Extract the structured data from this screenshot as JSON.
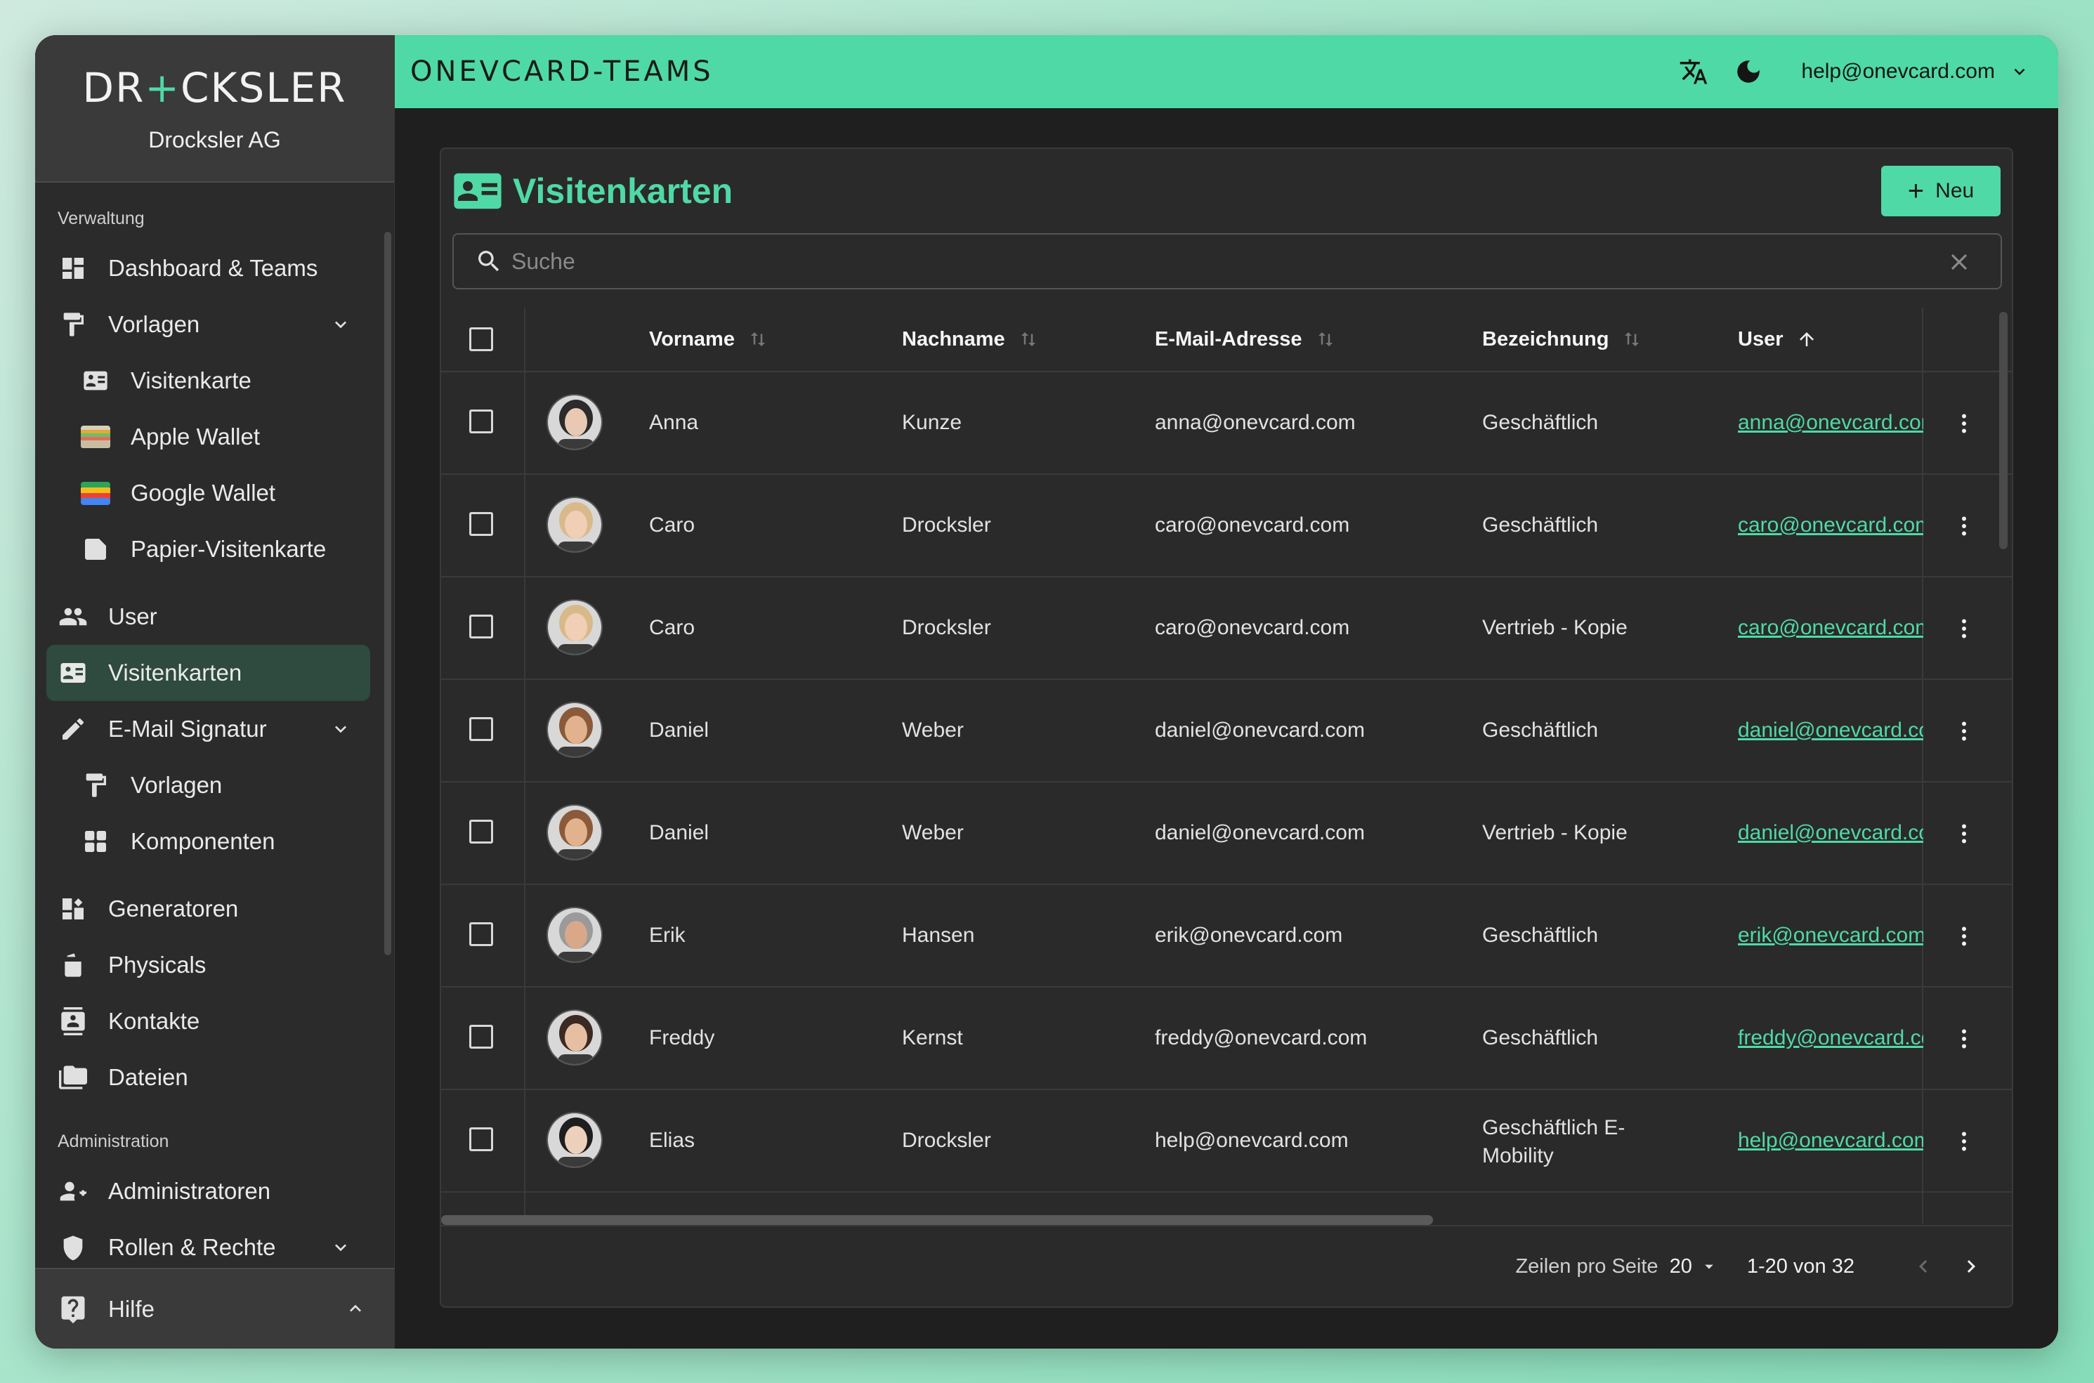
{
  "brand": {
    "logo_text": "DR+CKSLER",
    "logo_left": "DR",
    "logo_plus": "+",
    "logo_right": "CKSLER",
    "company": "Drocksler AG"
  },
  "topbar": {
    "app_title": "ONEVCARD-TEAMS",
    "user_email": "help@onevcard.com",
    "accent_color": "#4fd9a6"
  },
  "sidebar": {
    "section_management": "Verwaltung",
    "items": [
      {
        "label": "Dashboard & Teams",
        "icon": "dashboard-icon"
      },
      {
        "label": "Vorlagen",
        "icon": "paint-roller-icon",
        "expanded": true
      },
      {
        "label": "Visitenkarte",
        "icon": "contact-card-icon"
      },
      {
        "label": "Apple Wallet",
        "icon": "apple-wallet-icon"
      },
      {
        "label": "Google Wallet",
        "icon": "google-wallet-icon"
      },
      {
        "label": "Papier-Visitenkarte",
        "icon": "paper-card-icon"
      },
      {
        "label": "User",
        "icon": "users-icon"
      },
      {
        "label": "Visitenkarten",
        "icon": "contact-card-icon",
        "active": true
      },
      {
        "label": "E-Mail Signatur",
        "icon": "signature-icon",
        "expanded": true
      },
      {
        "label": "Vorlagen",
        "icon": "paint-roller-icon"
      },
      {
        "label": "Komponenten",
        "icon": "components-icon"
      },
      {
        "label": "Generatoren",
        "icon": "generators-icon"
      },
      {
        "label": "Physicals",
        "icon": "physicals-icon"
      },
      {
        "label": "Kontakte",
        "icon": "contacts-icon"
      },
      {
        "label": "Dateien",
        "icon": "folder-icon"
      }
    ],
    "section_admin": "Administration",
    "admin_items": [
      {
        "label": "Administratoren",
        "icon": "admin-icon"
      },
      {
        "label": "Rollen & Rechte",
        "icon": "roles-icon"
      }
    ],
    "help_label": "Hilfe"
  },
  "page": {
    "title": "Visitenkarten",
    "new_button": "Neu",
    "search_placeholder": "Suche"
  },
  "table": {
    "columns": [
      "Vorname",
      "Nachname",
      "E-Mail-Adresse",
      "Bezeichnung",
      "User"
    ],
    "rows": [
      {
        "first": "Anna",
        "last": "Kunze",
        "email": "anna@onevcard.com",
        "bez": "Geschäftlich",
        "user": "anna@onevcard.com"
      },
      {
        "first": "Caro",
        "last": "Drocksler",
        "email": "caro@onevcard.com",
        "bez": "Geschäftlich",
        "user": "caro@onevcard.com"
      },
      {
        "first": "Caro",
        "last": "Drocksler",
        "email": "caro@onevcard.com",
        "bez": "Vertrieb - Kopie",
        "user": "caro@onevcard.com"
      },
      {
        "first": "Daniel",
        "last": "Weber",
        "email": "daniel@onevcard.com",
        "bez": "Geschäftlich",
        "user": "daniel@onevcard.com"
      },
      {
        "first": "Daniel",
        "last": "Weber",
        "email": "daniel@onevcard.com",
        "bez": "Vertrieb - Kopie",
        "user": "daniel@onevcard.com"
      },
      {
        "first": "Erik",
        "last": "Hansen",
        "email": "erik@onevcard.com",
        "bez": "Geschäftlich",
        "user": "erik@onevcard.com"
      },
      {
        "first": "Freddy",
        "last": "Kernst",
        "email": "freddy@onevcard.com",
        "bez": "Geschäftlich",
        "user": "freddy@onevcard.com"
      },
      {
        "first": "Elias",
        "last": "Drocksler",
        "email": "help@onevcard.com",
        "bez": "Geschäftlich E-Mobility",
        "user": "help@onevcard.com"
      }
    ]
  },
  "pagination": {
    "rows_label": "Zeilen pro Seite",
    "rows_value": "20",
    "range": "1-20 von 32"
  }
}
